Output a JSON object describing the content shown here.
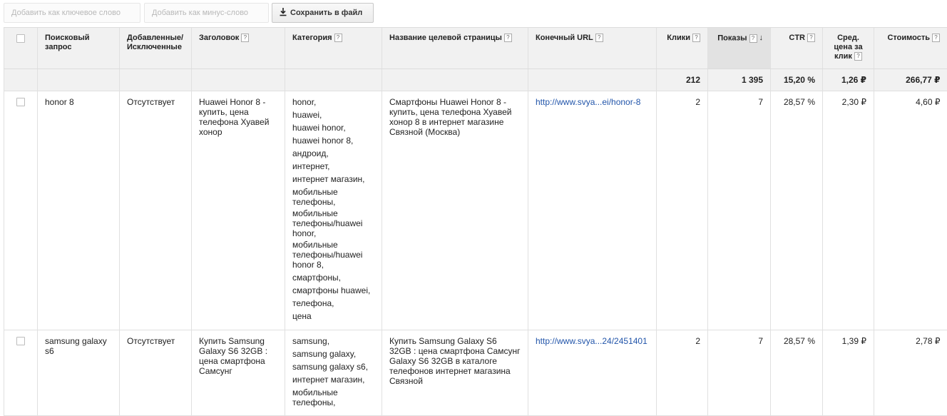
{
  "toolbar": {
    "add_keyword": "Добавить как ключевое слово",
    "add_negative": "Добавить как минус-слово",
    "save_file": "Сохранить в файл"
  },
  "columns": {
    "query": "Поисковый запрос",
    "added": "Добавленные/ Исключенные",
    "headline": "Заголовок",
    "category": "Категория",
    "page_title": "Название целевой страницы",
    "final_url": "Конечный URL",
    "clicks": "Клики",
    "impressions": "Показы",
    "ctr": "CTR",
    "avg_cpc": "Сред. цена за клик",
    "cost": "Стоимость"
  },
  "help_glyph": "?",
  "totals": {
    "clicks": "212",
    "impressions": "1 395",
    "ctr": "15,20 %",
    "avg_cpc": "1,26 ₽",
    "cost": "266,77 ₽"
  },
  "rows": [
    {
      "query": "honor 8",
      "added": "Отсутствует",
      "headline": "Huawei Honor 8 - купить, цена телефона Хуавей хонор",
      "categories": [
        "honor,",
        "huawei,",
        "huawei honor,",
        "huawei honor 8,",
        "андроид,",
        "интернет,",
        "интернет магазин,",
        "мобильные телефоны,",
        "мобильные телефоны/huawei honor,",
        "мобильные телефоны/huawei honor 8,",
        "смартфоны,",
        "смартфоны huawei,",
        "телефона,",
        "цена"
      ],
      "page_title": "Смартфоны Huawei Honor 8 - купить, цена телефона Хуавей хонор 8 в интернет магазине Связной (Москва)",
      "final_url": "http://www.svya...ei/honor-8",
      "clicks": "2",
      "impressions": "7",
      "ctr": "28,57 %",
      "avg_cpc": "2,30 ₽",
      "cost": "4,60 ₽"
    },
    {
      "query": "samsung galaxy s6",
      "added": "Отсутствует",
      "headline": "Купить Samsung Galaxy S6 32GB : цена смартфона Самсунг",
      "categories": [
        "samsung,",
        "samsung galaxy,",
        "samsung galaxy s6,",
        "интернет магазин,",
        "мобильные телефоны,"
      ],
      "page_title": "Купить Samsung Galaxy S6 32GB : цена смартфона Самсунг Galaxy S6 32GB в каталоге телефонов интернет магазина Связной",
      "final_url": "http://www.svya...24/2451401",
      "clicks": "2",
      "impressions": "7",
      "ctr": "28,57 %",
      "avg_cpc": "1,39 ₽",
      "cost": "2,78 ₽"
    }
  ]
}
